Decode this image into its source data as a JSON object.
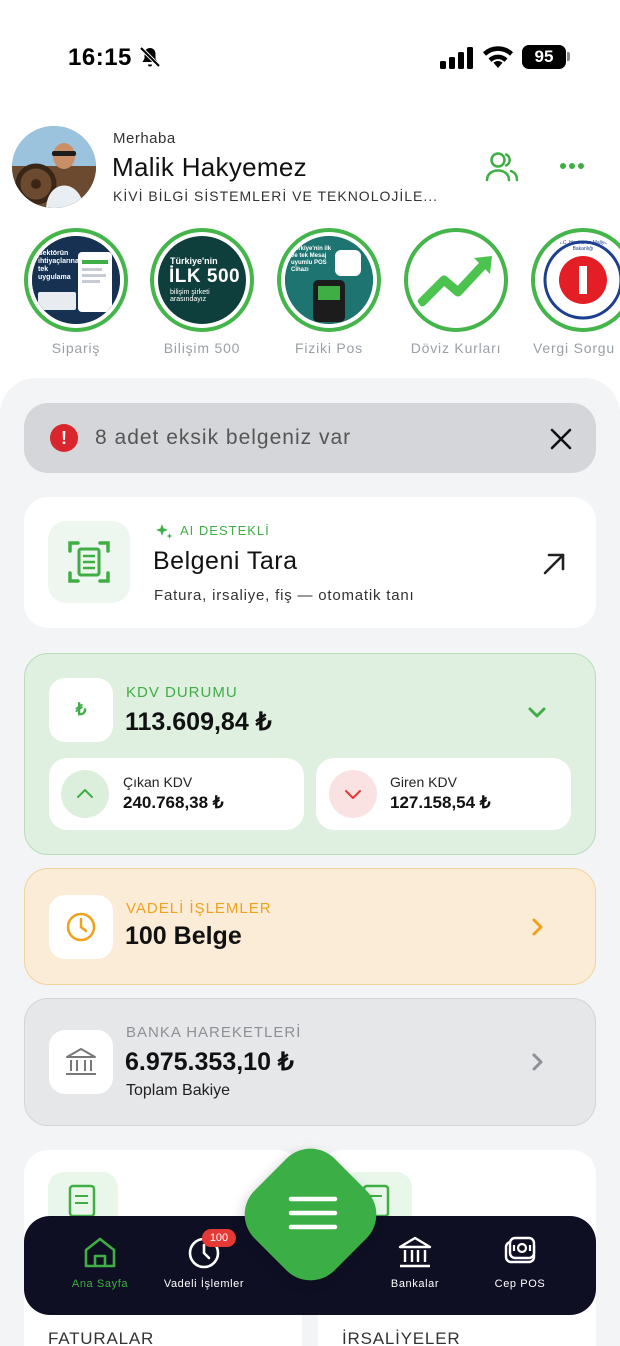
{
  "status_bar": {
    "time": "16:15",
    "battery": "95"
  },
  "header": {
    "greeting": "Merhaba",
    "user_name": "Malik Hakyemez",
    "company": "KİVİ BİLGİ SİSTEMLERİ VE TEKNOLOJİLE..."
  },
  "stories": [
    {
      "label": "Sipariş",
      "image_text": "Sektörün ihtiyaçlarına tek uygulama"
    },
    {
      "label": "Bilişim 500",
      "image_top": "Türkiye'nin",
      "image_main": "İLK 500",
      "image_sub": "bilişim şirketi arasındayız"
    },
    {
      "label": "Fiziki Pos",
      "image_text": "Türkiye'nin ilk ve tek Mesaj uyumlu POS Cihazı"
    },
    {
      "label": "Döviz Kurları"
    },
    {
      "label": "Vergi Sorgu",
      "image_text": "T.C. Hazine ve Maliye Bakanlığı"
    }
  ],
  "alert": {
    "text": "8 adet eksik belgeniz var"
  },
  "scan_card": {
    "badge": "AI DESTEKLİ",
    "title": "Belgeni Tara",
    "subtitle": "Fatura, irsaliye, fiş — otomatik tanı"
  },
  "kdv_card": {
    "icon_symbol": "₺",
    "label": "KDV DURUMU",
    "value": "113.609,84 ₺",
    "outgoing": {
      "label": "Çıkan KDV",
      "value": "240.768,38 ₺"
    },
    "incoming": {
      "label": "Giren KDV",
      "value": "127.158,54 ₺"
    }
  },
  "vadeli_card": {
    "label": "VADELİ İŞLEMLER",
    "value": "100 Belge"
  },
  "bank_card": {
    "label": "BANKA HAREKETLERİ",
    "value": "6.975.353,10 ₺",
    "sub": "Toplam Bakiye"
  },
  "tiles": [
    {
      "label": "FATURALAR"
    },
    {
      "label": "İRSALİYELER"
    }
  ],
  "bottom_nav": {
    "items": [
      {
        "label": "Ana Sayfa",
        "icon": "home-icon",
        "active": true
      },
      {
        "label": "Vadeli İşlemler",
        "icon": "clock-icon",
        "badge": "100"
      },
      {
        "label": "Bankalar",
        "icon": "bank-icon"
      },
      {
        "label": "Cep POS",
        "icon": "pos-icon"
      }
    ],
    "center_action": "menu-icon"
  },
  "colors": {
    "accent_green": "#3fae45",
    "warning_orange": "#f0a21c",
    "alert_red": "#d8262c",
    "nav_background": "#0f0f24"
  }
}
